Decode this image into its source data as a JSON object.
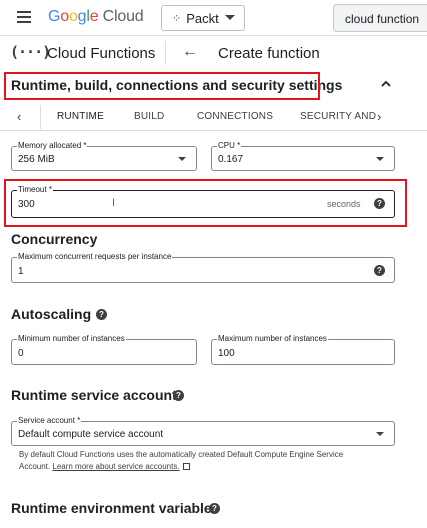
{
  "topbar": {
    "logo_letters": [
      "G",
      "o",
      "o",
      "g",
      "l",
      "e"
    ],
    "logo_suffix": "Cloud",
    "project_name": "Packt",
    "search_text": "cloud function"
  },
  "nav": {
    "product_title": "Cloud Functions",
    "page_title": "Create function"
  },
  "section": {
    "title": "Runtime, build, connections and security settings"
  },
  "tabs": [
    "RUNTIME",
    "BUILD",
    "CONNECTIONS",
    "SECURITY AND"
  ],
  "runtime": {
    "memory": {
      "label": "Memory allocated *",
      "value": "256 MiB"
    },
    "cpu": {
      "label": "CPU *",
      "value": "0.167"
    },
    "timeout": {
      "label": "Timeout *",
      "value": "300",
      "suffix": "seconds"
    }
  },
  "concurrency": {
    "heading": "Concurrency",
    "max_requests": {
      "label": "Maximum concurrent requests per instance",
      "value": "1"
    }
  },
  "autoscaling": {
    "heading": "Autoscaling",
    "min_instances": {
      "label": "Minimum number of instances",
      "value": "0"
    },
    "max_instances": {
      "label": "Maximum number of instances",
      "value": "100"
    }
  },
  "service_account": {
    "heading": "Runtime service account",
    "field": {
      "label": "Service account *",
      "value": "Default compute service account"
    },
    "help_text": "By default Cloud Functions uses the automatically created Default Compute Engine Service Account.",
    "link_text": "Learn more about service accounts."
  },
  "env_vars": {
    "heading": "Runtime environment variables"
  },
  "colors": {
    "highlight": "#e0161f",
    "text": "#202124",
    "field_border": "#80868b"
  },
  "icons": [
    "menu-icon",
    "project-dots-icon",
    "cloud-functions-icon",
    "arrow-back-icon",
    "chevron-up-icon",
    "chevron-left-icon",
    "chevron-right-icon",
    "help-icon",
    "text-cursor-icon",
    "open-in-new-icon",
    "dropdown-arrow-icon"
  ]
}
